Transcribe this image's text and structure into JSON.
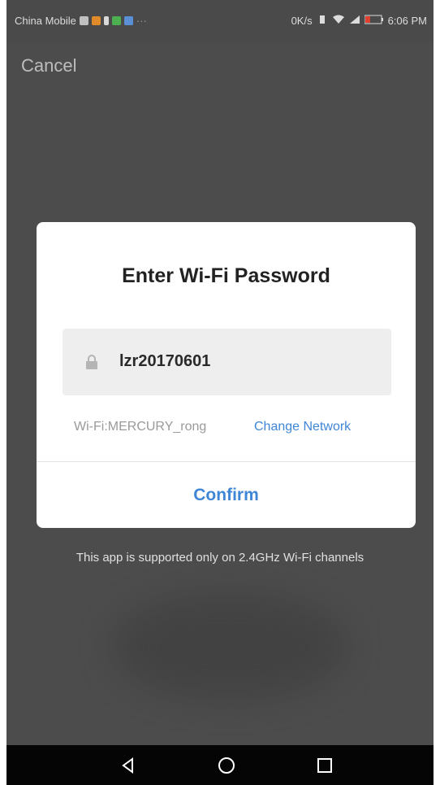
{
  "status_bar": {
    "carrier": "China Mobile",
    "speed": "0K/s",
    "time": "6:06 PM"
  },
  "header": {
    "cancel_label": "Cancel"
  },
  "dialog": {
    "title": "Enter Wi-Fi Password",
    "password_value": "lzr20170601",
    "wifi_label": "Wi-Fi:MERCURY_rong",
    "change_network_label": "Change Network",
    "confirm_label": "Confirm"
  },
  "note": "This app is supported only on 2.4GHz Wi-Fi channels",
  "colors": {
    "accent": "#3f86d6",
    "overlay": "#4c4c4c"
  },
  "icons": {
    "lock": "lock-icon",
    "back": "back-triangle-icon",
    "home": "home-circle-icon",
    "recents": "recents-square-icon"
  }
}
